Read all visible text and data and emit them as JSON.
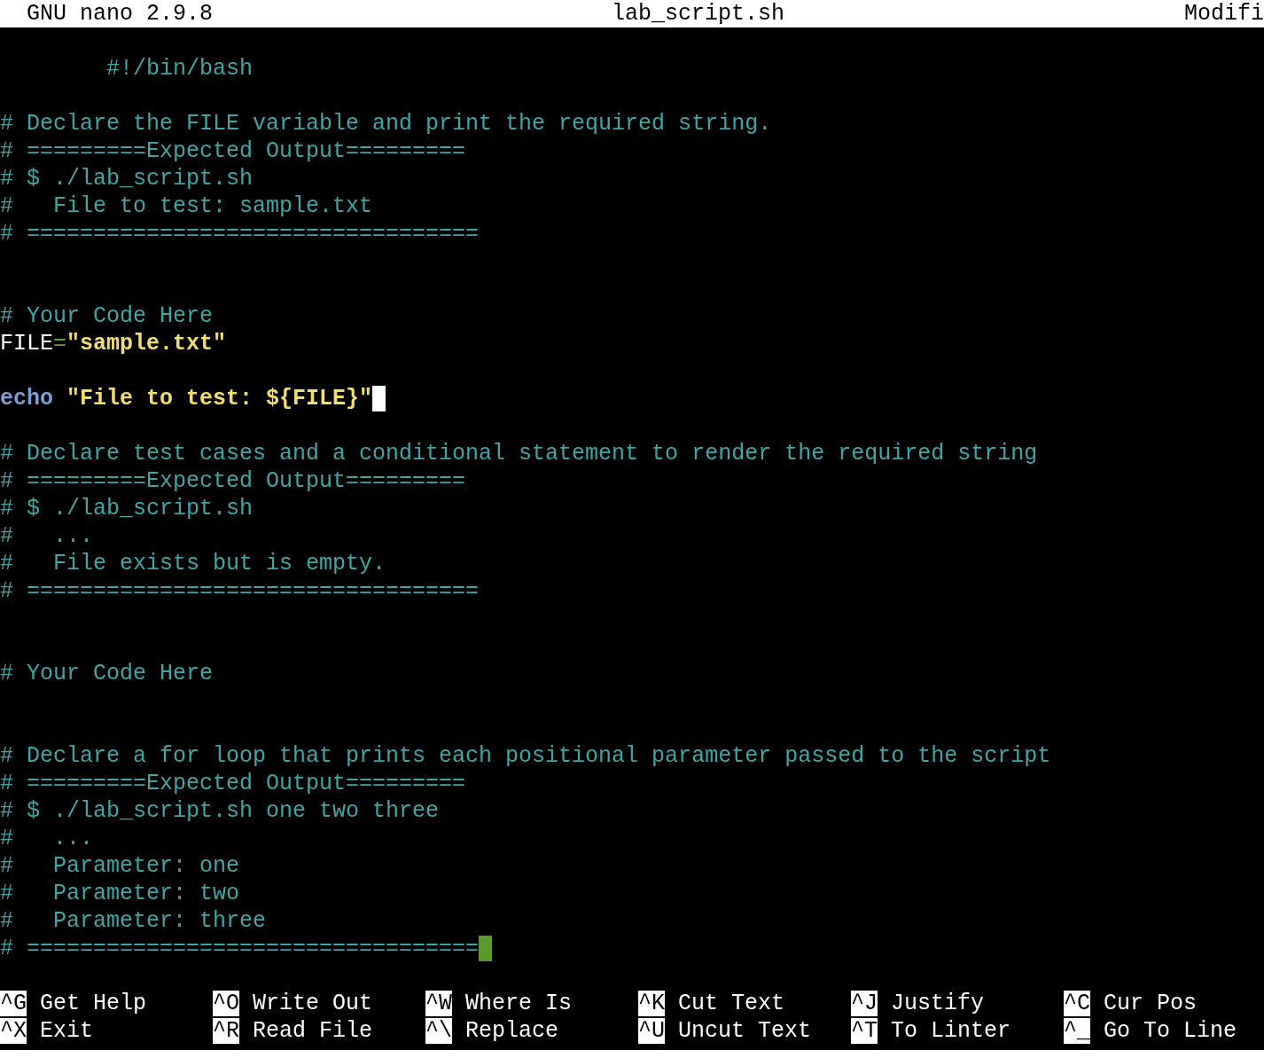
{
  "title_bar": {
    "app": "GNU nano 2.9.8",
    "file": "lab_script.sh",
    "status": "Modifi"
  },
  "lines": [
    {
      "kind": "code",
      "segments": [
        {
          "kind": "comment",
          "text": "        #!/bin/bash"
        }
      ]
    },
    {
      "kind": "blank"
    },
    {
      "kind": "code",
      "segments": [
        {
          "kind": "comment",
          "text": "# Declare the FILE variable and print the required string."
        }
      ]
    },
    {
      "kind": "code",
      "segments": [
        {
          "kind": "comment",
          "text": "# =========Expected Output========="
        }
      ]
    },
    {
      "kind": "code",
      "segments": [
        {
          "kind": "comment",
          "text": "# $ ./lab_script.sh"
        }
      ]
    },
    {
      "kind": "code",
      "segments": [
        {
          "kind": "comment",
          "text": "#   File to test: sample.txt"
        }
      ]
    },
    {
      "kind": "code",
      "segments": [
        {
          "kind": "comment",
          "text": "# =================================="
        }
      ]
    },
    {
      "kind": "blank"
    },
    {
      "kind": "blank"
    },
    {
      "kind": "code",
      "segments": [
        {
          "kind": "comment",
          "text": "# Your Code Here"
        }
      ]
    },
    {
      "kind": "code",
      "segments": [
        {
          "kind": "plain",
          "text": "FILE"
        },
        {
          "kind": "operator",
          "text": "="
        },
        {
          "kind": "string",
          "text": "\"sample.txt\""
        }
      ]
    },
    {
      "kind": "blank"
    },
    {
      "kind": "code",
      "cursor": true,
      "segments": [
        {
          "kind": "keyword",
          "text": "echo"
        },
        {
          "kind": "string",
          "text": " \"File to test: ${FILE}\""
        }
      ]
    },
    {
      "kind": "blank"
    },
    {
      "kind": "code",
      "segments": [
        {
          "kind": "comment",
          "text": "# Declare test cases and a conditional statement to render the required string"
        }
      ]
    },
    {
      "kind": "code",
      "segments": [
        {
          "kind": "comment",
          "text": "# =========Expected Output========="
        }
      ]
    },
    {
      "kind": "code",
      "segments": [
        {
          "kind": "comment",
          "text": "# $ ./lab_script.sh"
        }
      ]
    },
    {
      "kind": "code",
      "segments": [
        {
          "kind": "comment",
          "text": "#   ..."
        }
      ]
    },
    {
      "kind": "code",
      "segments": [
        {
          "kind": "comment",
          "text": "#   File exists but is empty."
        }
      ]
    },
    {
      "kind": "code",
      "segments": [
        {
          "kind": "comment",
          "text": "# =================================="
        }
      ]
    },
    {
      "kind": "blank"
    },
    {
      "kind": "blank"
    },
    {
      "kind": "code",
      "segments": [
        {
          "kind": "comment",
          "text": "# Your Code Here"
        }
      ]
    },
    {
      "kind": "blank"
    },
    {
      "kind": "blank"
    },
    {
      "kind": "code",
      "segments": [
        {
          "kind": "comment",
          "text": "# Declare a for loop that prints each positional parameter passed to the script"
        }
      ]
    },
    {
      "kind": "code",
      "segments": [
        {
          "kind": "comment",
          "text": "# =========Expected Output========="
        }
      ]
    },
    {
      "kind": "code",
      "segments": [
        {
          "kind": "comment",
          "text": "# $ ./lab_script.sh one two three"
        }
      ]
    },
    {
      "kind": "code",
      "segments": [
        {
          "kind": "comment",
          "text": "#   ..."
        }
      ]
    },
    {
      "kind": "code",
      "segments": [
        {
          "kind": "comment",
          "text": "#   Parameter: one"
        }
      ]
    },
    {
      "kind": "code",
      "segments": [
        {
          "kind": "comment",
          "text": "#   Parameter: two"
        }
      ]
    },
    {
      "kind": "code",
      "segments": [
        {
          "kind": "comment",
          "text": "#   Parameter: three"
        }
      ]
    },
    {
      "kind": "code",
      "trailing_whitespace": true,
      "segments": [
        {
          "kind": "comment",
          "text": "# =================================="
        }
      ]
    }
  ],
  "shortcuts": [
    {
      "key": "^G",
      "label": "Get Help"
    },
    {
      "key": "^O",
      "label": "Write Out"
    },
    {
      "key": "^W",
      "label": "Where Is"
    },
    {
      "key": "^K",
      "label": "Cut Text"
    },
    {
      "key": "^J",
      "label": "Justify"
    },
    {
      "key": "^C",
      "label": "Cur Pos"
    },
    {
      "key": "^X",
      "label": "Exit"
    },
    {
      "key": "^R",
      "label": "Read File"
    },
    {
      "key": "^\\",
      "label": "Replace"
    },
    {
      "key": "^U",
      "label": "Uncut Text"
    },
    {
      "key": "^T",
      "label": "To Linter"
    },
    {
      "key": "^_",
      "label": "Go To Line"
    }
  ]
}
